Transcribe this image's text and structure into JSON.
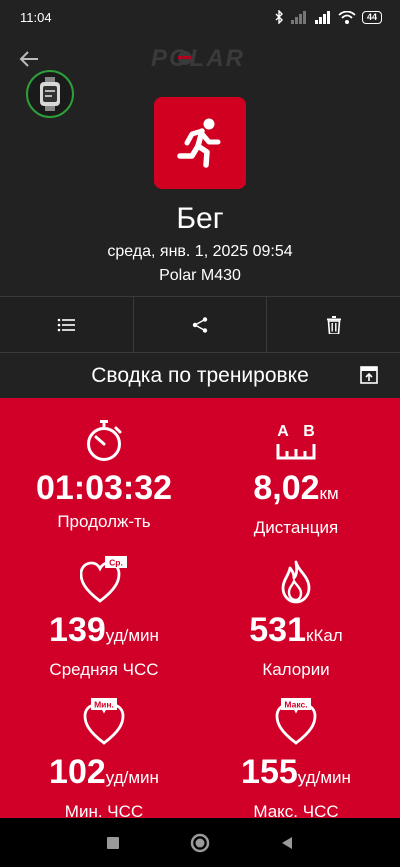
{
  "status": {
    "time": "11:04",
    "battery": "44"
  },
  "header": {
    "back_icon": "arrow-left-icon",
    "brand": "POLAR"
  },
  "device_badge": {
    "icon": "watch-icon"
  },
  "sport": {
    "icon": "running-icon",
    "title": "Бег",
    "datetime": "среда, янв. 1, 2025 09:54",
    "device": "Polar M430"
  },
  "actions": [
    {
      "icon": "list-icon"
    },
    {
      "icon": "share-icon"
    },
    {
      "icon": "trash-icon"
    }
  ],
  "summary": {
    "title": "Сводка по тренировке",
    "export_icon": "export-icon"
  },
  "stats": {
    "duration": {
      "value": "01:03:32",
      "unit": "",
      "label": "Продолж-ть"
    },
    "distance": {
      "value": "8,02",
      "unit": "км",
      "label": "Дистанция",
      "icon_labels": [
        "A",
        "B"
      ]
    },
    "avg_hr": {
      "value": "139",
      "unit": "уд/мин",
      "label": "Средняя ЧСС",
      "badge": "Ср."
    },
    "calories": {
      "value": "531",
      "unit": "кКал",
      "label": "Калории"
    },
    "min_hr": {
      "value": "102",
      "unit": "уд/мин",
      "label": "Мин. ЧСС",
      "badge": "Мин."
    },
    "max_hr": {
      "value": "155",
      "unit": "уд/мин",
      "label": "Макс. ЧСС",
      "badge": "Макс."
    }
  },
  "colors": {
    "accent": "#d10028",
    "background": "#222222",
    "device_ring": "#2e9e3a"
  }
}
